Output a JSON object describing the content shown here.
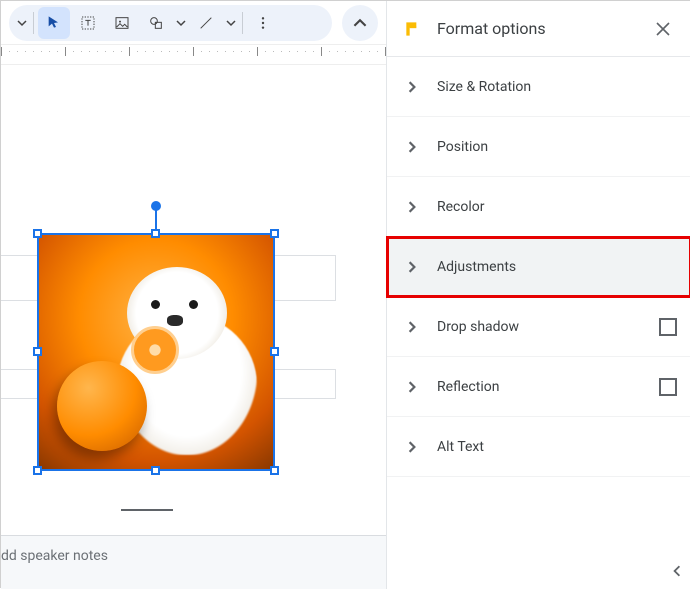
{
  "toolbar": {
    "tools": [
      "select",
      "textbox",
      "image",
      "shape",
      "line",
      "more"
    ]
  },
  "panel": {
    "title": "Format options",
    "rows": [
      {
        "label": "Size & Rotation",
        "checkbox": false,
        "highlighted": false
      },
      {
        "label": "Position",
        "checkbox": false,
        "highlighted": false
      },
      {
        "label": "Recolor",
        "checkbox": false,
        "highlighted": false
      },
      {
        "label": "Adjustments",
        "checkbox": false,
        "highlighted": true
      },
      {
        "label": "Drop shadow",
        "checkbox": true,
        "highlighted": false
      },
      {
        "label": "Reflection",
        "checkbox": true,
        "highlighted": false
      },
      {
        "label": "Alt Text",
        "checkbox": false,
        "highlighted": false
      }
    ]
  },
  "notes": {
    "placeholder": "dd speaker notes"
  }
}
